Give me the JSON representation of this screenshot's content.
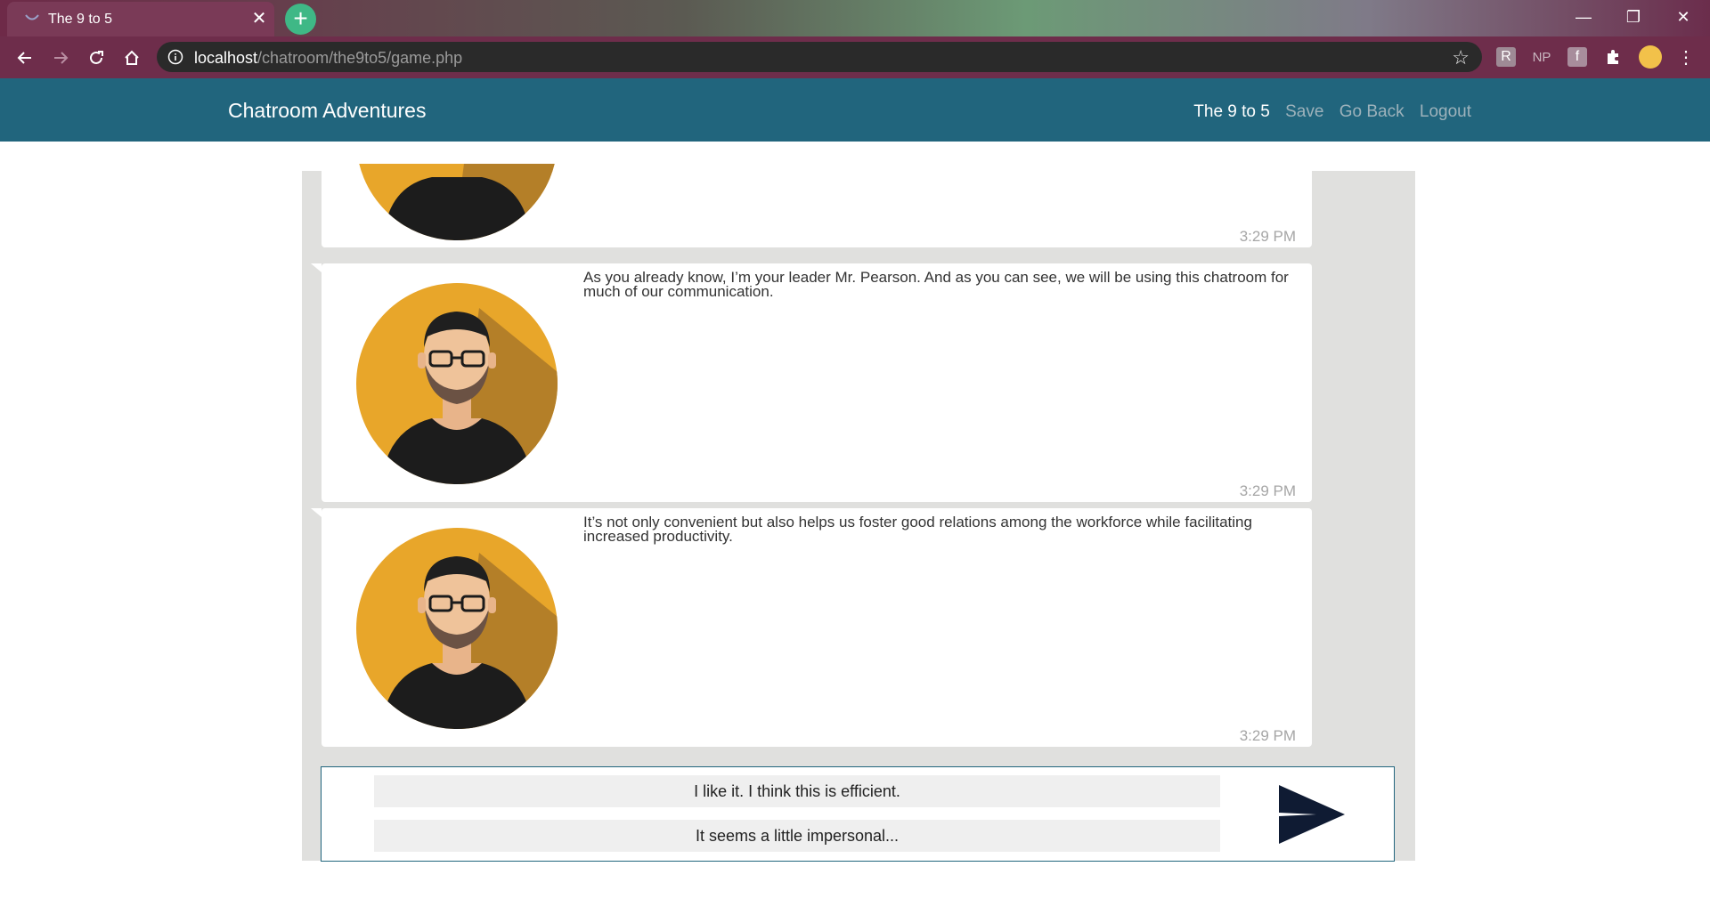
{
  "browser": {
    "tab_title": "The 9 to 5",
    "new_tab": "+",
    "url_host": "localhost",
    "url_path": "/chatroom/the9to5/game.php",
    "extensions": [
      "NP"
    ]
  },
  "site": {
    "brand": "Chatroom Adventures",
    "nav": {
      "current": "The 9 to 5",
      "save": "Save",
      "go_back": "Go Back",
      "logout": "Logout"
    }
  },
  "messages": [
    {
      "text": "",
      "time": "3:29 PM"
    },
    {
      "text": "As you already know, I’m your leader Mr. Pearson. And as you can see, we will be using this chatroom for much of our communication.",
      "time": "3:29 PM"
    },
    {
      "text": "It’s not only convenient but also helps us foster good relations among the workforce while facilitating increased productivity.",
      "time": "3:29 PM"
    }
  ],
  "choices": [
    "I like it. I think this is efficient.",
    "It seems a little impersonal..."
  ],
  "colors": {
    "navbar": "#21657d",
    "panel": "#e0e0de",
    "avatar_bg": "#e8a62a",
    "send_arrow": "#0f1b33"
  }
}
